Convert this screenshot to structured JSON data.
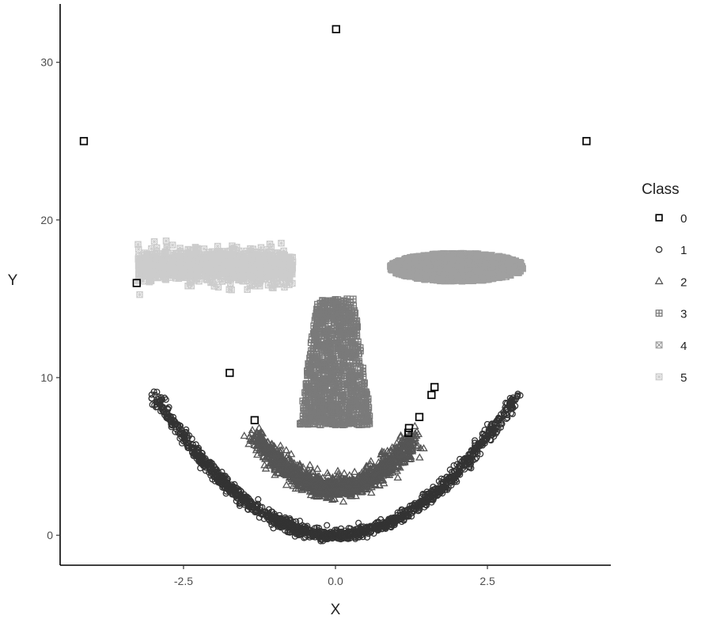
{
  "chart_data": {
    "type": "scatter",
    "title": "",
    "xlabel": "X",
    "ylabel": "Y",
    "xlim": [
      -4.53,
      4.53
    ],
    "ylim": [
      -1.9,
      33.7
    ],
    "xticks": [
      -2.5,
      0.0,
      2.5
    ],
    "xtick_labels": [
      "-2.5",
      "0.0",
      "2.5"
    ],
    "yticks": [
      0,
      10,
      20,
      30
    ],
    "ytick_labels": [
      "0",
      "10",
      "20",
      "30"
    ],
    "grid": false,
    "legend": {
      "title": "Class",
      "placement": "right",
      "entries": [
        {
          "label": "0",
          "shape": "square-open",
          "color": "#000000"
        },
        {
          "label": "1",
          "shape": "circle-open",
          "color": "#333333"
        },
        {
          "label": "2",
          "shape": "triangle-open",
          "color": "#555555"
        },
        {
          "label": "3",
          "shape": "square-plus",
          "color": "#7a7a7a"
        },
        {
          "label": "4",
          "shape": "square-x",
          "color": "#a0a0a0"
        },
        {
          "label": "5",
          "shape": "square-cross",
          "color": "#cccccc"
        }
      ]
    },
    "series": [
      {
        "name": "0",
        "description": "outliers",
        "points": [
          [
            -4.14,
            25.0
          ],
          [
            0.01,
            32.1
          ],
          [
            4.13,
            25.0
          ],
          [
            -3.27,
            16.0
          ],
          [
            -1.74,
            10.3
          ],
          [
            -1.33,
            7.3
          ],
          [
            1.63,
            9.4
          ],
          [
            1.58,
            8.9
          ],
          [
            1.38,
            7.5
          ],
          [
            1.21,
            6.8
          ],
          [
            1.2,
            6.5
          ]
        ]
      },
      {
        "name": "1",
        "description": "outer arc y = x^2 with noise",
        "cluster": {
          "kind": "parabola",
          "x_range": [
            -3.0,
            3.0
          ],
          "a": 1.0,
          "y_offset": 0.0,
          "noise_sd": 0.18,
          "n": 1400
        }
      },
      {
        "name": "2",
        "description": "inner smile arc",
        "cluster": {
          "kind": "parabola",
          "x_range": [
            -1.3,
            1.3
          ],
          "a": 1.9,
          "y_offset": 3.0,
          "noise_sd": 0.32,
          "n": 1200
        }
      },
      {
        "name": "3",
        "description": "nose block",
        "cluster": {
          "kind": "trapezoid",
          "x_range_bottom": [
            -0.6,
            0.6
          ],
          "x_range_top": [
            -0.3,
            0.3
          ],
          "y_range": [
            7.0,
            15.0
          ],
          "n": 900
        }
      },
      {
        "name": "4",
        "description": "right eye ellipse",
        "cluster": {
          "kind": "ellipse",
          "center": [
            2.0,
            17.0
          ],
          "radii": [
            1.1,
            0.9
          ],
          "n": 1400
        }
      },
      {
        "name": "5",
        "description": "left eye cloud",
        "cluster": {
          "kind": "box-noise",
          "x_range": [
            -3.25,
            -0.7
          ],
          "y_range": [
            15.7,
            18.4
          ],
          "n": 1100
        }
      }
    ]
  }
}
